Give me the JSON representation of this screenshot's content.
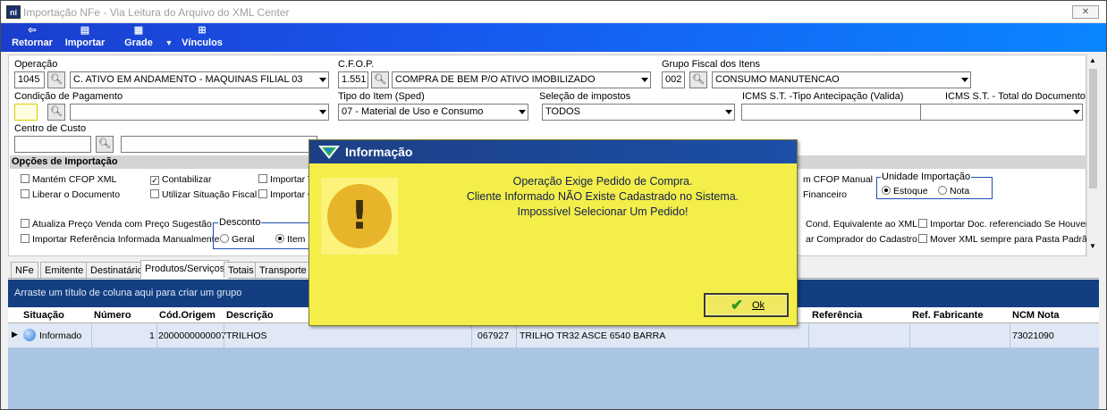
{
  "window": {
    "title": "Importação NFe - Via Leitura do Arquivo do XML Center",
    "app_icon_text": "ni",
    "close_label": "✕"
  },
  "toolbar": {
    "retornar": "Retornar",
    "importar": "Importar",
    "grade": "Grade",
    "vinculos": "Vínculos"
  },
  "form": {
    "operacao_label": "Operação",
    "operacao_code": "1045",
    "operacao_value": "C. ATIVO EM ANDAMENTO - MAQUINAS FILIAL 03",
    "cfop_label": "C.F.O.P.",
    "cfop_code": "1.551",
    "cfop_value": "COMPRA DE BEM P/O ATIVO IMOBILIZADO",
    "grupo_label": "Grupo Fiscal dos Itens",
    "grupo_code": "002",
    "grupo_value": "CONSUMO MANUTENCAO",
    "condicao_label": "Condição de Pagamento",
    "condicao_code": "",
    "condicao_value": "",
    "tipo_item_label": "Tipo do Item (Sped)",
    "tipo_item_value": "07 - Material de Uso e Consumo",
    "selecao_label": "Seleção de impostos",
    "selecao_value": "TODOS",
    "icms_tipo_label": "ICMS S.T. -Tipo Antecipação (Valida)",
    "icms_tipo_value": "",
    "icms_total_label": "ICMS S.T. - Total do Documento",
    "icms_total_value": "",
    "centro_label": "Centro de Custo",
    "centro_code": "",
    "centro_value": ""
  },
  "opcoes": {
    "title": "Opções de Importação",
    "mantem_cfop": "Mantém CFOP XML",
    "contabilizar": "Contabilizar",
    "importar_t": "Importar T",
    "liberar_doc": "Liberar o Documento",
    "utilizar_situacao": "Utilizar Situação Fiscal",
    "importar_c": "Importar C",
    "atualiza_preco": "Atualiza Preço Venda com Preço Sugestão",
    "importar_referencia": "Importar Referência Informada Manualmente",
    "desconto_label": "Desconto",
    "desconto_geral": "Geral",
    "desconto_item": "Item",
    "cfop_manual": "m CFOP Manual",
    "financeiro": "Financeiro",
    "unidade_label": "Unidade Importação",
    "unidade_estoque": "Estoque",
    "unidade_nota": "Nota",
    "cond_equivalente": "Cond. Equivalente ao XML",
    "comprador_cadastro": "ar Comprador do Cadastro",
    "importar_doc_ref": "Importar Doc. referenciado Se Houver",
    "mover_xml": "Mover XML sempre para Pasta Padrão"
  },
  "tabs": [
    "NFe",
    "Emitente",
    "Destinatário",
    "Produtos/Serviços",
    "Totais",
    "Transporte"
  ],
  "grid": {
    "group_hint": "Arraste um título de coluna aqui para criar um grupo",
    "columns": {
      "situacao": "Situação",
      "numero": "Número",
      "cod_origem": "Cód.Origem",
      "descricao": "Descrição",
      "referencia": "Referência",
      "ref_fabricante": "Ref. Fabricante",
      "ncm": "NCM Nota"
    },
    "row": {
      "situacao": "Informado",
      "numero": "1",
      "cod_origem": "2000000000007",
      "descricao": "TRILHOS",
      "codigo": "067927",
      "descricao_produto": "TRILHO TR32 ASCE 6540 BARRA",
      "referencia": "",
      "ref_fabricante": "",
      "ncm": "73021090"
    }
  },
  "dialog": {
    "title": "Informação",
    "line1": "Operação Exige Pedido de Compra.",
    "line2": "Cliente Informado NÃO Existe Cadastrado no Sistema.",
    "line3": "Impossível Selecionar Um Pedido!",
    "ok_label": "Ok"
  }
}
